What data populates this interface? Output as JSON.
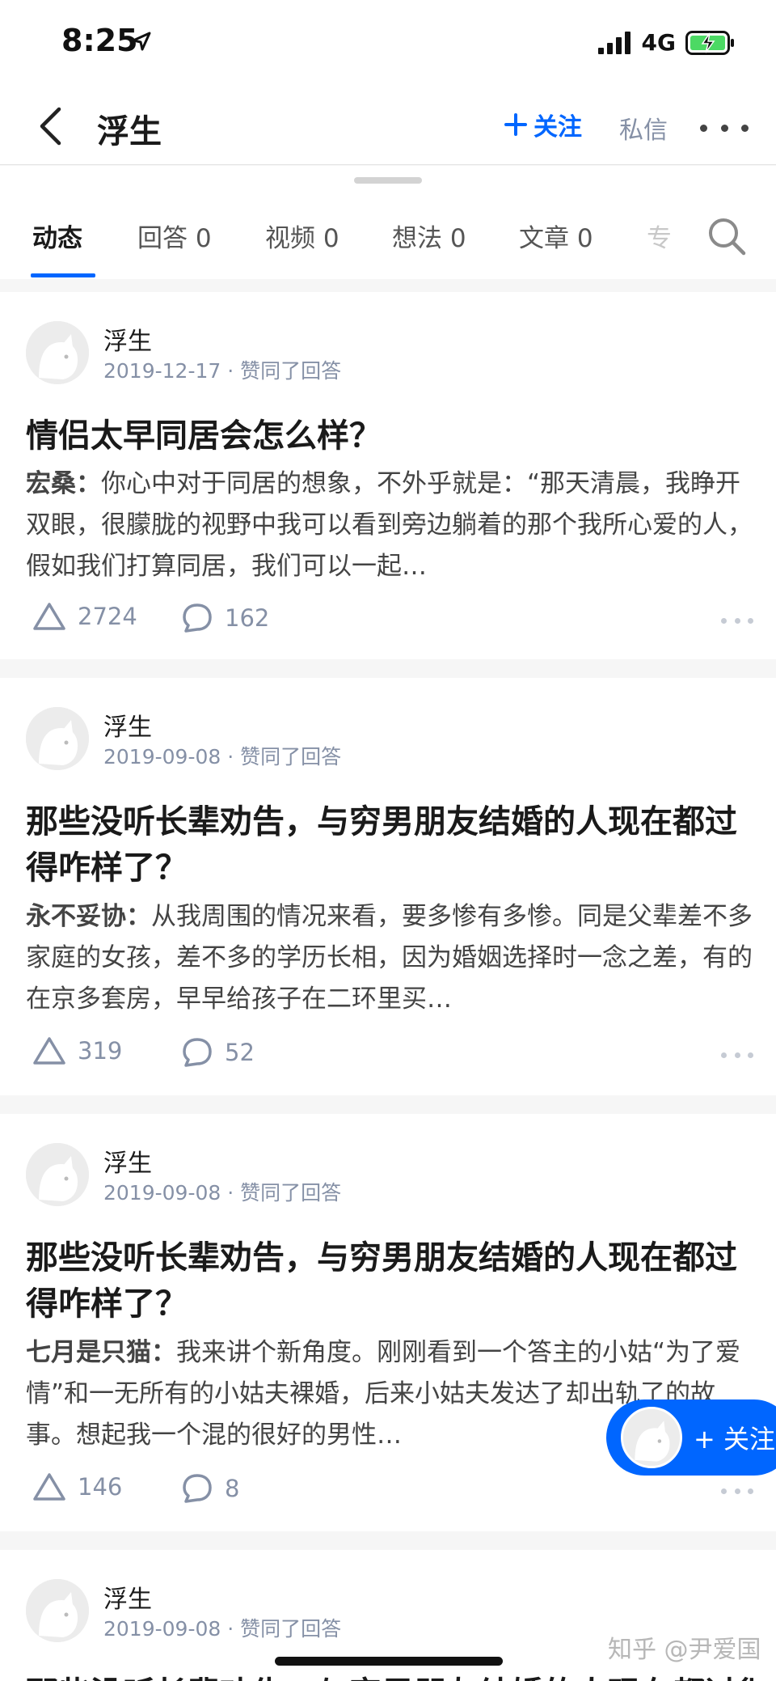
{
  "status_bar": {
    "time": "8:25",
    "network": "4G"
  },
  "nav": {
    "title": "浮生",
    "follow_label": "关注",
    "message_label": "私信"
  },
  "tabs": [
    {
      "label": "动态"
    },
    {
      "label": "回答 0"
    },
    {
      "label": "视频 0"
    },
    {
      "label": "想法 0"
    },
    {
      "label": "文章 0"
    },
    {
      "label": "专"
    }
  ],
  "feed": [
    {
      "author": "浮生",
      "meta": "2019-12-17 · 赞同了回答",
      "title": "情侣太早同居会怎么样？",
      "answer_author": "宏桑：",
      "excerpt": "你心中对于同居的想象，不外乎就是：“那天清晨，我睁开双眼，很朦胧的视野中我可以看到旁边躺着的那个我所心爱的人，假如我们打算同居，我们可以一起…",
      "likes": "2724",
      "comments": "162"
    },
    {
      "author": "浮生",
      "meta": "2019-09-08 · 赞同了回答",
      "title": "那些没听长辈劝告，与穷男朋友结婚的人现在都过得咋样了？",
      "answer_author": "永不妥协：",
      "excerpt": "从我周围的情况来看，要多惨有多惨。同是父辈差不多家庭的女孩，差不多的学历长相，因为婚姻选择时一念之差，有的在京多套房，早早给孩子在二环里买…",
      "likes": "319",
      "comments": "52"
    },
    {
      "author": "浮生",
      "meta": "2019-09-08 · 赞同了回答",
      "title": "那些没听长辈劝告，与穷男朋友结婚的人现在都过得咋样了？",
      "answer_author": "七月是只猫：",
      "excerpt": "我来讲个新角度。刚刚看到一个答主的小姑“为了爱情”和一无所有的小姑夫裸婚，后来小姑夫发达了却出轨了的故事。想起我一个混的很好的男性…",
      "likes": "146",
      "comments": "8"
    },
    {
      "author": "浮生",
      "meta": "2019-09-08 · 赞同了回答",
      "title": "那些没听长辈劝告，与穷男朋友结婚的人现在都过得咋样了？"
    }
  ],
  "float_follow": {
    "label": "+ 关注"
  },
  "watermark": "知乎 @尹爱国",
  "colors": {
    "accent": "#0066ff",
    "meta": "#8590a6",
    "background": "#f6f6f6"
  }
}
